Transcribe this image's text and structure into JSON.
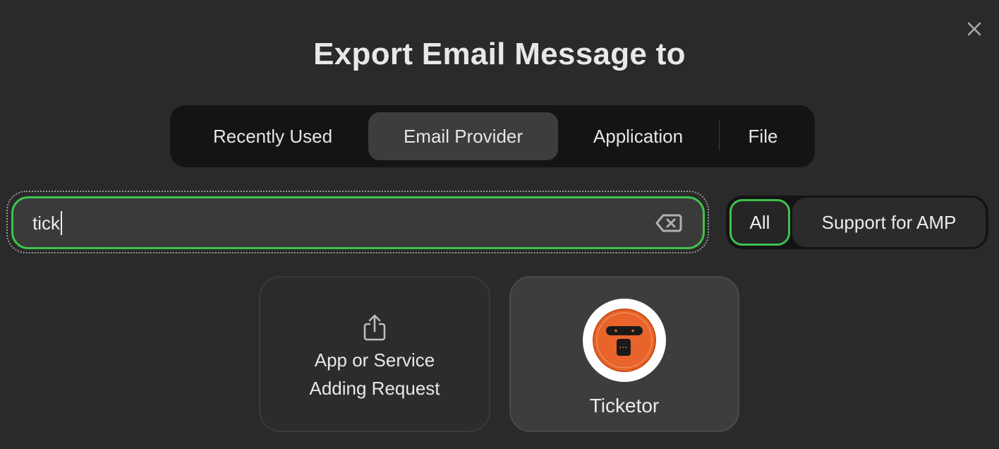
{
  "dialog": {
    "title": "Export Email Message to",
    "close_icon": "close-icon"
  },
  "tabs": [
    {
      "label": "Recently Used",
      "selected": false
    },
    {
      "label": "Email Provider",
      "selected": true
    },
    {
      "label": "Application",
      "selected": false
    },
    {
      "label": "File",
      "selected": false
    }
  ],
  "search": {
    "value": "tick",
    "clear_icon": "backspace-clear-icon",
    "accent_color": "#3ec24c"
  },
  "filter": {
    "options": [
      {
        "label": "All",
        "selected": true
      },
      {
        "label": "Support for AMP",
        "selected": false
      }
    ]
  },
  "results": [
    {
      "label_line1": "App or Service",
      "label_line2": "Adding Request",
      "icon": "share-icon"
    },
    {
      "label": "Ticketor",
      "icon": "ticketor-logo",
      "brand_color": "#e8642a",
      "selected": true
    }
  ]
}
